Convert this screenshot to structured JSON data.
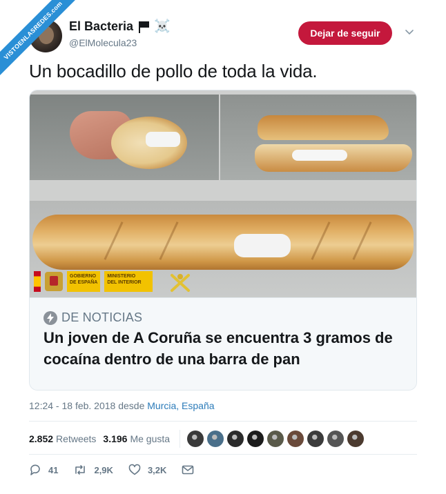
{
  "watermark": {
    "text": "VISTOENLASREDES",
    "sub": ".com"
  },
  "author": {
    "display_name": "El Bacteria",
    "handle": "@ElMolecula23",
    "emoji_flag": "black-flag-icon",
    "emoji_skull": "☠️"
  },
  "follow_button": {
    "label": "Dejar de seguir",
    "color": "#c4183c"
  },
  "menu": {
    "icon": "chevron-down-icon"
  },
  "tweet": {
    "text": "Un bocadillo de pollo de toda la vida."
  },
  "card": {
    "source": "DE NOTICIAS",
    "title": "Un joven de A Coruña se encuentra 3 gramos de cocaína dentro de una barra de pan",
    "logos": {
      "gobierno": "GOBIERNO\nDE ESPAÑA",
      "ministerio": "MINISTERIO\nDEL INTERIOR"
    }
  },
  "meta": {
    "time": "12:24 - 18 feb. 2018 desde ",
    "location": "Murcia, España"
  },
  "stats": {
    "retweets_count": "2.852",
    "retweets_label": "Retweets",
    "likes_count": "3.196",
    "likes_label": "Me gusta",
    "liker_colors": [
      "#3a3a3a",
      "#4a6f8a",
      "#2b2b2b",
      "#1c1c1c",
      "#5a5a4a",
      "#6a4a3a",
      "#3b3b3b",
      "#555555",
      "#4b3a2f"
    ]
  },
  "actions": {
    "replies": "41",
    "retweets": "2,9K",
    "likes": "3,2K"
  },
  "colors": {
    "link": "#2b7bb9",
    "muted": "#657786",
    "ribbon": "#2a8fd6"
  }
}
